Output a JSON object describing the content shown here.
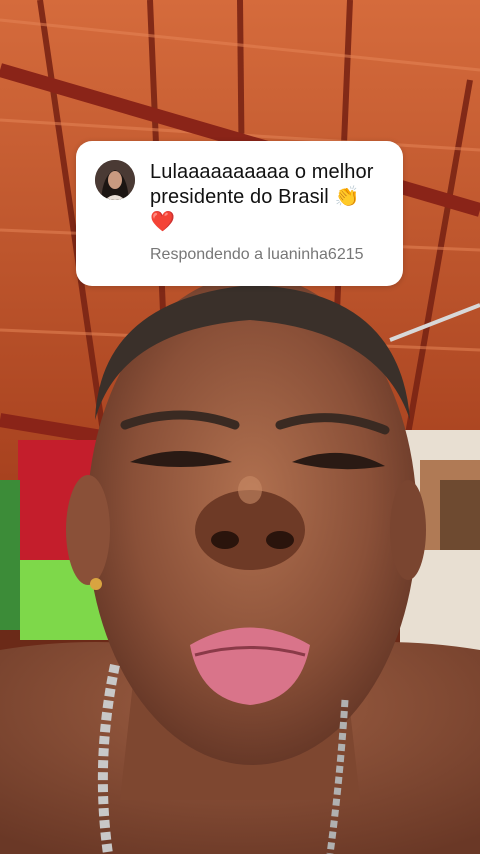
{
  "reply": {
    "comment_text": "Lulaaaaaaaaaa o melhor presidente do Brasil",
    "emoji_1": "👏",
    "emoji_2": "❤️",
    "replying_to": "Respondendo a luaninha6215"
  },
  "colors": {
    "card_background": "#ffffff",
    "comment_text": "#111111",
    "subtext": "#777777",
    "roof_tile": "#c0502a",
    "roof_beam": "#8a2418"
  },
  "icons": {
    "avatar": "profile-photo",
    "heart": "red-heart-emoji",
    "clap": "clapping-hands-emoji"
  }
}
